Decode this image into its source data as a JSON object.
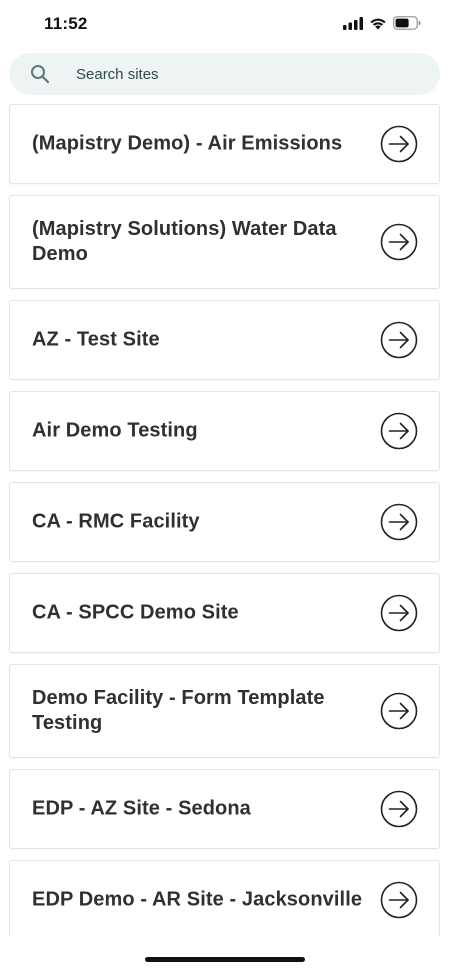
{
  "status_bar": {
    "time": "11:52",
    "icons": [
      "cellular-signal-icon",
      "wifi-icon",
      "battery-icon"
    ]
  },
  "search": {
    "placeholder": "Search sites",
    "value": ""
  },
  "sites": [
    {
      "name": "(Mapistry Demo) - Air Emissions"
    },
    {
      "name": "(Mapistry Solutions) Water Data Demo"
    },
    {
      "name": "AZ - Test Site"
    },
    {
      "name": "Air Demo Testing"
    },
    {
      "name": "CA - RMC Facility"
    },
    {
      "name": "CA - SPCC Demo Site"
    },
    {
      "name": "Demo Facility - Form Template Testing"
    },
    {
      "name": "EDP - AZ Site - Sedona"
    },
    {
      "name": "EDP Demo - AR Site - Jacksonville"
    }
  ],
  "colors": {
    "search_background": "#eef3f3",
    "card_border": "#e4e4e4",
    "text": "#303030"
  }
}
